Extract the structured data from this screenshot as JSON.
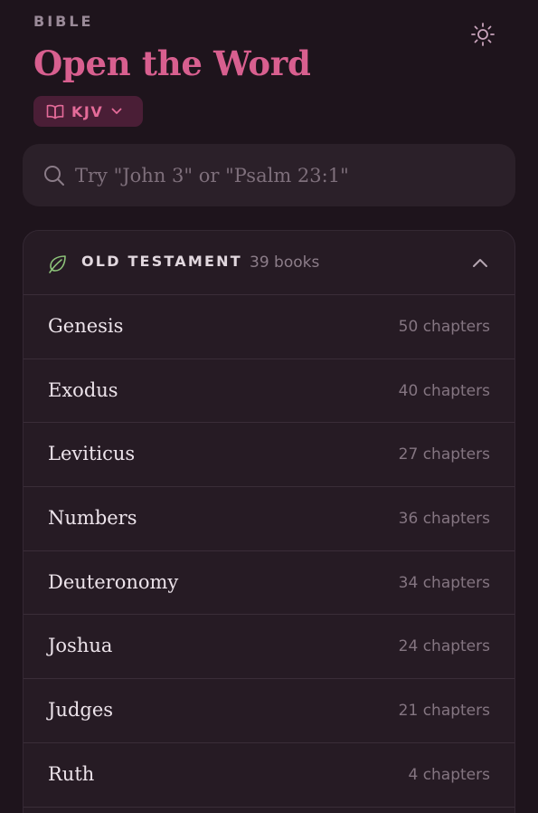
{
  "header": {
    "eyebrow": "BIBLE",
    "title": "Open the Word",
    "theme_toggle_icon": "sun-icon"
  },
  "version": {
    "label": "KJV",
    "icon": "open-book-icon",
    "dropdown_icon": "chevron-down-icon"
  },
  "search": {
    "placeholder": "Try \"John 3\" or \"Psalm 23:1\"",
    "value": "",
    "icon": "search-icon"
  },
  "old_testament": {
    "title": "OLD TESTAMENT",
    "count": "39 books",
    "icon": "leaf-icon",
    "expanded": true,
    "books": [
      {
        "name": "Genesis",
        "chapters": "50 chapters"
      },
      {
        "name": "Exodus",
        "chapters": "40 chapters"
      },
      {
        "name": "Leviticus",
        "chapters": "27 chapters"
      },
      {
        "name": "Numbers",
        "chapters": "36 chapters"
      },
      {
        "name": "Deuteronomy",
        "chapters": "34 chapters"
      },
      {
        "name": "Joshua",
        "chapters": "24 chapters"
      },
      {
        "name": "Judges",
        "chapters": "21 chapters"
      },
      {
        "name": "Ruth",
        "chapters": "4 chapters"
      }
    ]
  },
  "colors": {
    "background": "#1e141c",
    "accent": "#d85f8f",
    "pill_bg": "#4a1e36",
    "leaf_green": "#8cc279"
  }
}
